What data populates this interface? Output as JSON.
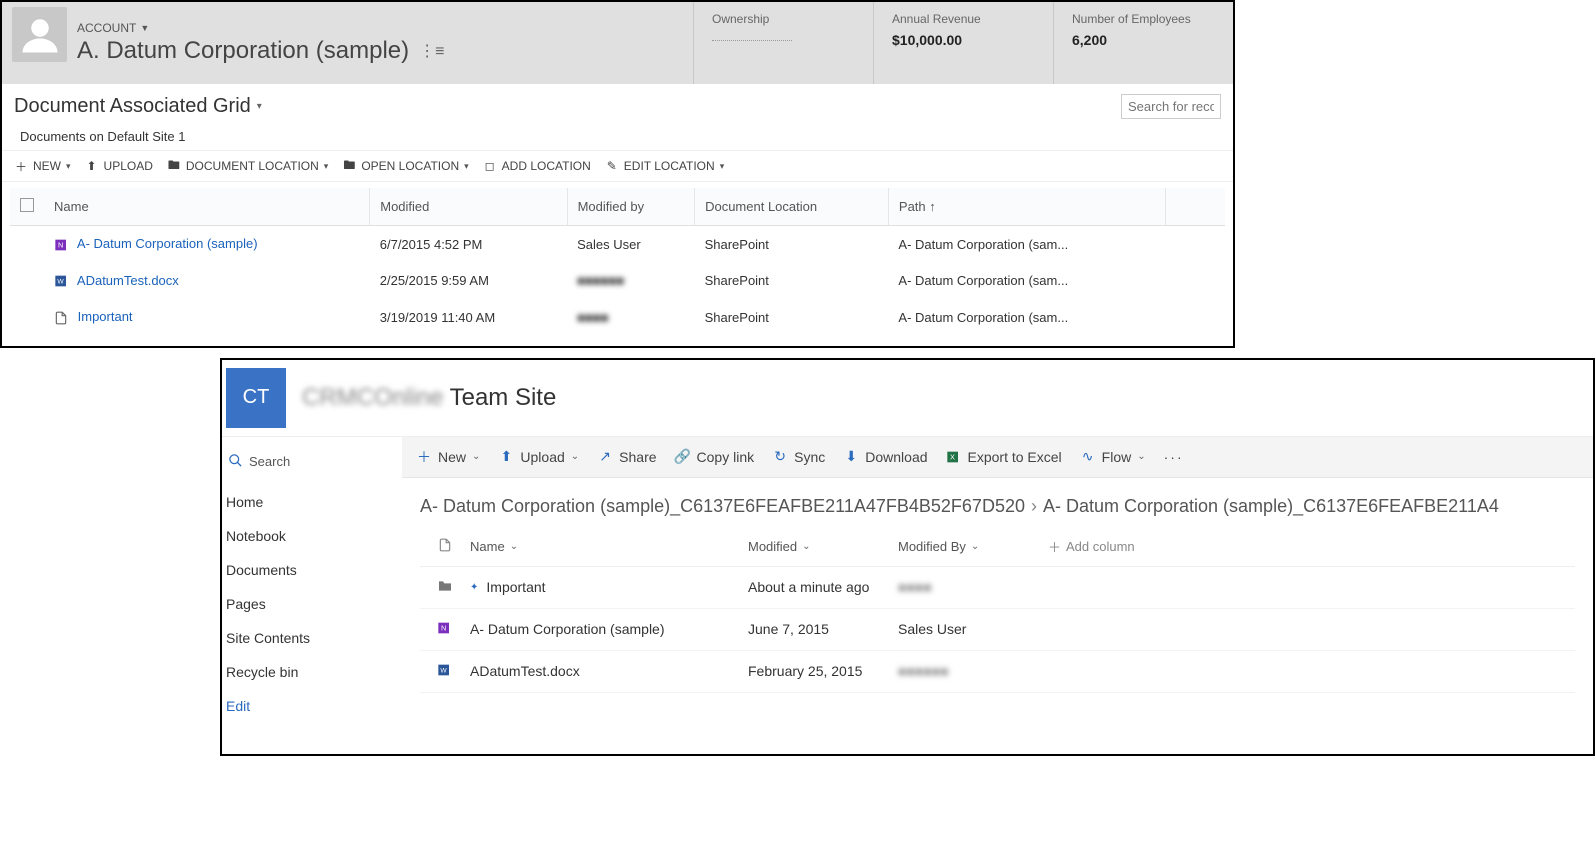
{
  "crm": {
    "entityType": "ACCOUNT",
    "entityName": "A. Datum Corporation (sample)",
    "metrics": [
      {
        "label": "Ownership",
        "value": "",
        "dashed": true
      },
      {
        "label": "Annual Revenue",
        "value": "$10,000.00"
      },
      {
        "label": "Number of Employees",
        "value": "6,200"
      }
    ],
    "gridTitle": "Document Associated Grid",
    "searchPlaceholder": "Search for reco",
    "subtitle": "Documents on Default Site 1",
    "toolbar": [
      "NEW",
      "UPLOAD",
      "DOCUMENT LOCATION",
      "OPEN LOCATION",
      "ADD LOCATION",
      "EDIT LOCATION"
    ],
    "columns": [
      "Name",
      "Modified",
      "Modified by",
      "Document Location",
      "Path ↑"
    ],
    "rows": [
      {
        "icon": "onenote",
        "name": "A- Datum Corporation (sample)",
        "modified": "6/7/2015 4:52 PM",
        "by": "Sales User",
        "byBlur": false,
        "location": "SharePoint",
        "path": "A- Datum Corporation (sam..."
      },
      {
        "icon": "word",
        "name": "ADatumTest.docx",
        "modified": "2/25/2015 9:59 AM",
        "by": "■■■■■■",
        "byBlur": true,
        "location": "SharePoint",
        "path": "A- Datum Corporation (sam..."
      },
      {
        "icon": "generic",
        "name": "Important",
        "modified": "3/19/2019 11:40 AM",
        "by": "■■■■",
        "byBlur": true,
        "location": "SharePoint",
        "path": "A- Datum Corporation (sam..."
      }
    ]
  },
  "sp": {
    "logo": "CT",
    "siteBlur": "CRMCOnline",
    "siteName": "Team Site",
    "searchLabel": "Search",
    "nav": [
      "Home",
      "Notebook",
      "Documents",
      "Pages",
      "Site Contents",
      "Recycle bin"
    ],
    "editLabel": "Edit",
    "cmdbar": [
      {
        "icon": "plus",
        "label": "New",
        "dd": true
      },
      {
        "icon": "upload",
        "label": "Upload",
        "dd": true
      },
      {
        "icon": "share",
        "label": "Share"
      },
      {
        "icon": "link",
        "label": "Copy link"
      },
      {
        "icon": "sync",
        "label": "Sync"
      },
      {
        "icon": "download",
        "label": "Download"
      },
      {
        "icon": "excel",
        "label": "Export to Excel"
      },
      {
        "icon": "flow",
        "label": "Flow",
        "dd": true
      }
    ],
    "breadcrumb": [
      "A- Datum Corporation (sample)_C6137E6FEAFBE211A47FB4B52F67D520",
      "A- Datum Corporation (sample)_C6137E6FEAFBE211A4"
    ],
    "fileColumns": {
      "name": "Name",
      "modified": "Modified",
      "by": "Modified By",
      "add": "Add column"
    },
    "files": [
      {
        "icon": "folder",
        "name": "Important",
        "modified": "About a minute ago",
        "by": "■■■■",
        "byBlur": true,
        "new": true
      },
      {
        "icon": "onenote",
        "name": "A- Datum Corporation (sample)",
        "modified": "June 7, 2015",
        "by": "Sales User",
        "byBlur": false
      },
      {
        "icon": "word",
        "name": "ADatumTest.docx",
        "modified": "February 25, 2015",
        "by": "■■■■■■",
        "byBlur": true
      }
    ]
  }
}
